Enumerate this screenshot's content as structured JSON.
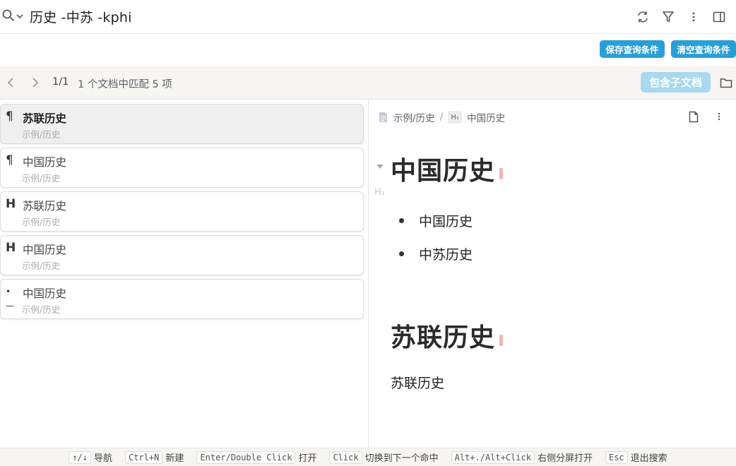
{
  "search": {
    "query": "历史 -中苏 -kphi"
  },
  "toolbar": {
    "save_label": "保存查询条件",
    "clear_label": "清空查询条件"
  },
  "nav": {
    "page": "1/1",
    "match_text": "1 个文档中匹配 5 项",
    "include_children": "包含子文档"
  },
  "results": [
    {
      "type_icon": "paragraph-icon",
      "glyph": "¶",
      "title": "苏联历史",
      "path": "示例/历史",
      "active": true
    },
    {
      "type_icon": "paragraph-icon",
      "glyph": "¶",
      "title": "中国历史",
      "path": "示例/历史",
      "active": false
    },
    {
      "type_icon": "heading-icon",
      "glyph": "H",
      "title": "苏联历史",
      "path": "示例/历史",
      "active": false
    },
    {
      "type_icon": "heading-icon",
      "glyph": "H",
      "title": "中国历史",
      "path": "示例/历史",
      "active": false
    },
    {
      "type_icon": "list-icon",
      "glyph": "•—",
      "title": "中国历史",
      "path": "示例/历史",
      "active": false
    }
  ],
  "preview": {
    "breadcrumb_doc": "示例/历史",
    "breadcrumb_sep": "/",
    "breadcrumb_badge": "H₁",
    "breadcrumb_heading": "中国历史",
    "heading1": "中国历史",
    "heading_marker": "H₁",
    "bullets": [
      "中国历史",
      "中苏历史"
    ],
    "heading2": "苏联历史",
    "paragraph": "苏联历史"
  },
  "footer": {
    "hints": [
      {
        "key": "↑/↓",
        "label": "导航"
      },
      {
        "key": "Ctrl+N",
        "label": "新建"
      },
      {
        "key": "Enter/Double Click",
        "label": "打开"
      },
      {
        "key": "Click",
        "label": "切换到下一个命中"
      },
      {
        "key": "Alt+./Alt+Click",
        "label": "右侧分屏打开"
      },
      {
        "key": "Esc",
        "label": "退出搜索"
      }
    ]
  },
  "colors": {
    "accent": "#2a9fd6",
    "accent_disabled": "#a9d8ef",
    "caret": "#f3b3b3"
  }
}
